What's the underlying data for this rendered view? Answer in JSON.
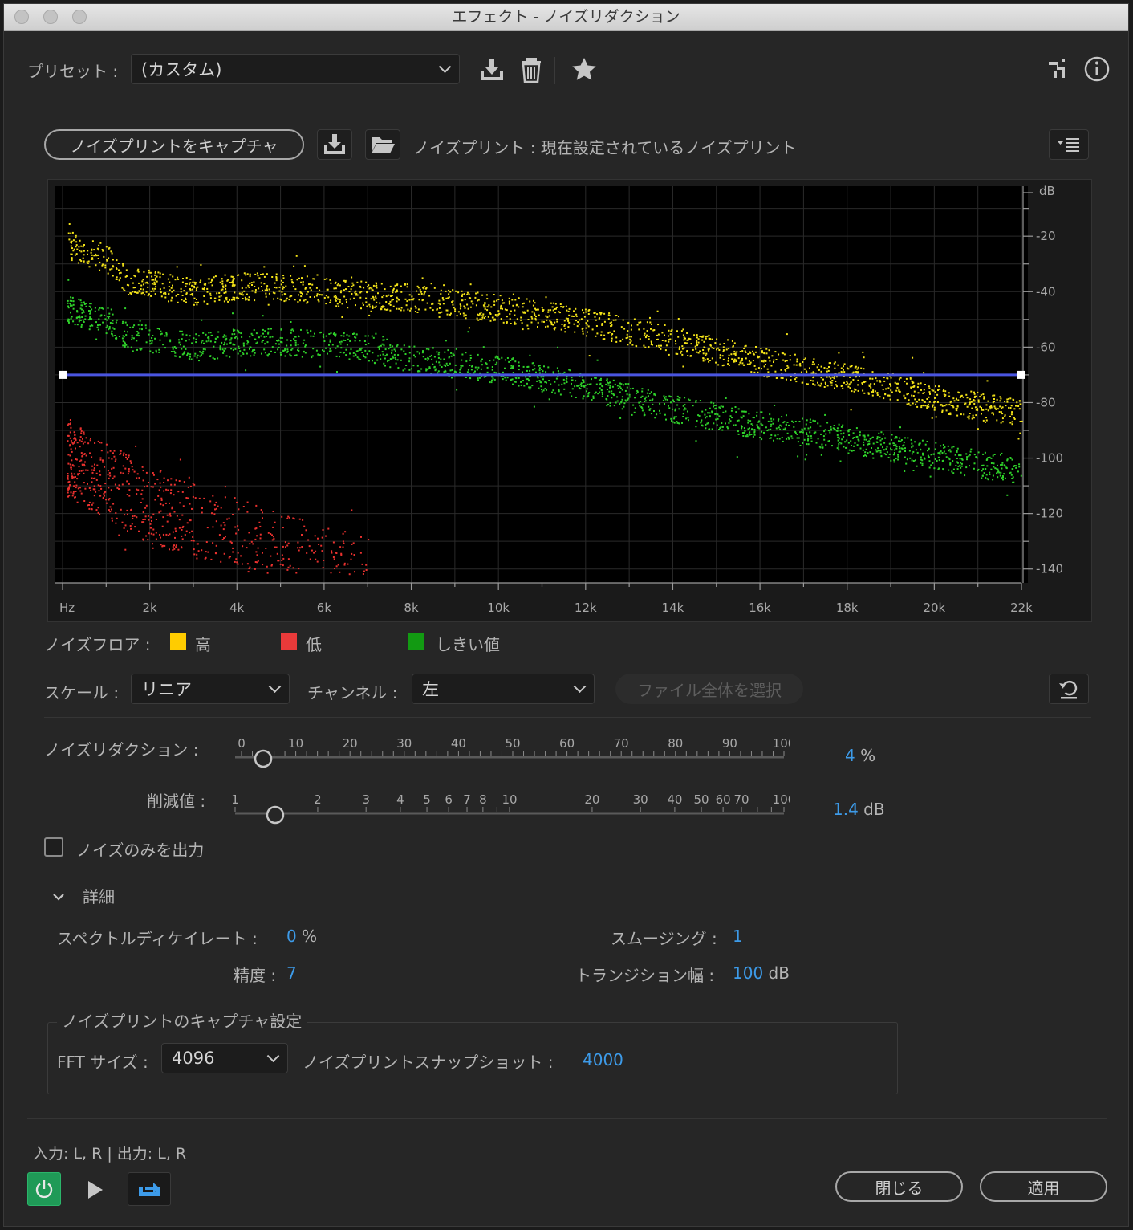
{
  "window": {
    "title": "エフェクト - ノイズリダクション"
  },
  "preset": {
    "label": "プリセット :",
    "value": "(カスタム)"
  },
  "capture": {
    "button": "ノイズプリントをキャプチャ",
    "noiseprint_text": "ノイズプリント : 現在設定されているノイズプリント"
  },
  "chart_data": {
    "type": "scatter",
    "x_ticks": [
      "Hz",
      "2k",
      "4k",
      "6k",
      "8k",
      "10k",
      "12k",
      "14k",
      "16k",
      "18k",
      "20k",
      "22k"
    ],
    "y_ticks": [
      "-20",
      "-40",
      "-60",
      "-80",
      "-100",
      "-120",
      "-140"
    ],
    "y_unit": "dB",
    "xlim": [
      0,
      22000
    ],
    "ylim": [
      -145,
      -2
    ],
    "threshold_db": -70,
    "series": [
      {
        "name": "高",
        "color": "#f2e218",
        "points": [
          [
            100,
            -23
          ],
          [
            1000,
            -28
          ],
          [
            1500,
            -36
          ],
          [
            2000,
            -37
          ],
          [
            3000,
            -40
          ],
          [
            4000,
            -38
          ],
          [
            5000,
            -38
          ],
          [
            6000,
            -40
          ],
          [
            7000,
            -41
          ],
          [
            8000,
            -42
          ],
          [
            9000,
            -44
          ],
          [
            10000,
            -46
          ],
          [
            11000,
            -48
          ],
          [
            12000,
            -51
          ],
          [
            13000,
            -54
          ],
          [
            14000,
            -57
          ],
          [
            15000,
            -61
          ],
          [
            16000,
            -65
          ],
          [
            17000,
            -68
          ],
          [
            18000,
            -71
          ],
          [
            19000,
            -74
          ],
          [
            20000,
            -78
          ],
          [
            21000,
            -81
          ],
          [
            22000,
            -83
          ]
        ]
      },
      {
        "name": "低",
        "color": "#e8312e",
        "points": [
          [
            100,
            -100
          ],
          [
            1000,
            -108
          ],
          [
            2000,
            -117
          ],
          [
            3000,
            -121
          ],
          [
            4000,
            -127
          ],
          [
            5000,
            -134
          ],
          [
            6000,
            -138
          ],
          [
            6500,
            -140
          ],
          [
            8000,
            -140
          ]
        ]
      },
      {
        "name": "しきい値",
        "color": "#2fd12a",
        "points": [
          [
            100,
            -46
          ],
          [
            1000,
            -51
          ],
          [
            1500,
            -56
          ],
          [
            2000,
            -57
          ],
          [
            3000,
            -60
          ],
          [
            4000,
            -58
          ],
          [
            5000,
            -58
          ],
          [
            6000,
            -59
          ],
          [
            7000,
            -60
          ],
          [
            8000,
            -64
          ],
          [
            9000,
            -66
          ],
          [
            10000,
            -68
          ],
          [
            11000,
            -71
          ],
          [
            12000,
            -74
          ],
          [
            13000,
            -78
          ],
          [
            14000,
            -82
          ],
          [
            15000,
            -85
          ],
          [
            16000,
            -88
          ],
          [
            17000,
            -90
          ],
          [
            18000,
            -93
          ],
          [
            19000,
            -96
          ],
          [
            20000,
            -99
          ],
          [
            21000,
            -102
          ],
          [
            22000,
            -104
          ]
        ]
      }
    ]
  },
  "legend": {
    "label": "ノイズフロア :",
    "high": "高",
    "low": "低",
    "threshold": "しきい値",
    "colors": {
      "high": "#ffcc00",
      "low": "#e93a3a",
      "threshold": "#129a12"
    }
  },
  "controls": {
    "scale_label": "スケール :",
    "scale_value": "リニア",
    "channel_label": "チャンネル :",
    "channel_value": "左",
    "select_all": "ファイル全体を選択"
  },
  "noise_reduction": {
    "label": "ノイズリダクション :",
    "scale": [
      "0",
      "10",
      "20",
      "30",
      "40",
      "50",
      "60",
      "70",
      "80",
      "90",
      "100"
    ],
    "value": "4",
    "unit": "%"
  },
  "reduce_by": {
    "label": "削減値 :",
    "scale": [
      "1",
      "2",
      "3",
      "4",
      "5",
      "6",
      "7",
      "8",
      "10",
      "20",
      "30",
      "40",
      "50",
      "60",
      "70",
      "100"
    ],
    "value": "1.4",
    "unit": "dB"
  },
  "output_noise": {
    "label": "ノイズのみを出力"
  },
  "advanced": {
    "title": "詳細",
    "spectral_decay_label": "スペクトルディケイレート :",
    "spectral_decay_value": "0",
    "spectral_decay_unit": "%",
    "smoothing_label": "スムージング :",
    "smoothing_value": "1",
    "precision_label": "精度 :",
    "precision_value": "7",
    "transition_label": "トランジション幅 :",
    "transition_value": "100",
    "transition_unit": "dB"
  },
  "capture_settings": {
    "title": "ノイズプリントのキャプチャ設定",
    "fft_label": "FFT サイズ :",
    "fft_value": "4096",
    "snapshots_label": "ノイズプリントスナップショット :",
    "snapshots_value": "4000"
  },
  "footer": {
    "io": "入力: L, R | 出力: L, R",
    "close": "閉じる",
    "apply": "適用"
  }
}
